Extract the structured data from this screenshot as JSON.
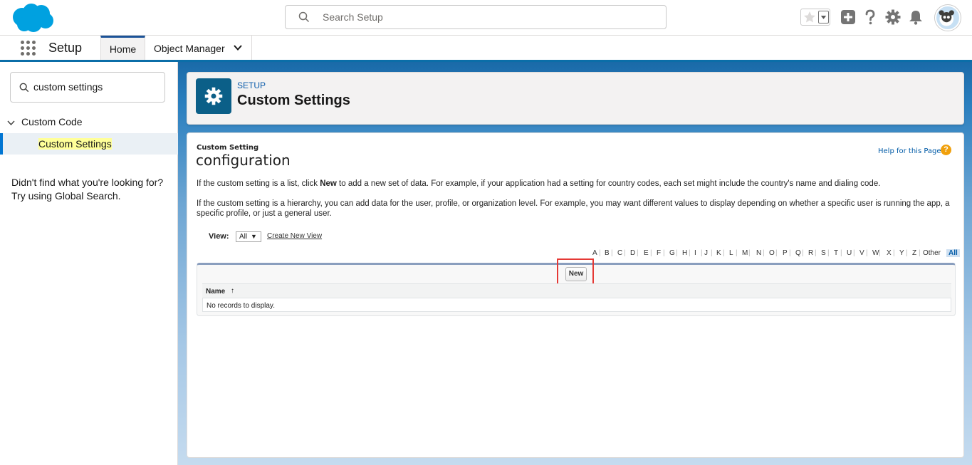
{
  "header": {
    "search_placeholder": "Search Setup",
    "icons": [
      "salesforce-cloud-logo",
      "star-icon",
      "chevron-down-icon",
      "plus-icon",
      "question-icon",
      "gear-icon",
      "bell-icon",
      "avatar"
    ]
  },
  "context_bar": {
    "app_name": "Setup",
    "tabs": [
      {
        "label": "Home",
        "active": true
      },
      {
        "label": "Object Manager",
        "active": false
      }
    ]
  },
  "sidebar": {
    "search_value": "custom settings",
    "group_label": "Custom Code",
    "item_label": "Custom Settings",
    "help_text": "Didn't find what you're looking for? Try using Global Search."
  },
  "page_header": {
    "eyebrow": "SETUP",
    "title": "Custom Settings"
  },
  "content": {
    "type_label": "Custom Setting",
    "setting_name": "configuration",
    "help_link": "Help for this Page",
    "help_icon_glyph": "?",
    "desc1_pre": "If the custom setting is a list, click ",
    "desc1_bold": "New",
    "desc1_post": " to add a new set of data. For example, if your application had a setting for country codes, each set might include the country's name and dialing code.",
    "desc2": "If the custom setting is a hierarchy, you can add data for the user, profile, or organization level. For example, you may want different values to display depending on whether a specific user is running the app, a specific profile, or just a general user.",
    "view_label": "View:",
    "view_selected": "All",
    "view_caret": "▼",
    "create_view_link": "Create New View",
    "alpha": [
      "A",
      "B",
      "C",
      "D",
      "E",
      "F",
      "G",
      "H",
      "I",
      "J",
      "K",
      "L",
      "M",
      "N",
      "O",
      "P",
      "Q",
      "R",
      "S",
      "T",
      "U",
      "V",
      "W",
      "X",
      "Y",
      "Z",
      "Other",
      "All"
    ],
    "new_button": "New",
    "column_header": "Name",
    "sort_arrow": "↑",
    "empty_text": "No records to display."
  },
  "colors": {
    "brand_blue": "#0176d3",
    "setup_icon_bg": "#0b5f88",
    "highlight": "#ffff99",
    "annotation_red": "#e53935"
  }
}
